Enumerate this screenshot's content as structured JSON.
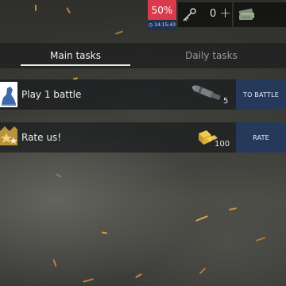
{
  "header": {
    "sale_percent": "50%",
    "sale_timer": "14:15:43",
    "keys_count": "0",
    "add_label": "+"
  },
  "tabs": [
    {
      "label": "Main tasks",
      "active": true
    },
    {
      "label": "Daily tasks",
      "active": false
    }
  ],
  "tasks": [
    {
      "title": "Play 1 battle",
      "reward_icon": "shell-icon",
      "reward_qty": "5",
      "action_label": "TO BATTLE"
    },
    {
      "title": "Rate us!",
      "reward_icon": "gold-bars-icon",
      "reward_qty": "100",
      "action_label": "RATE"
    }
  ],
  "colors": {
    "sale_red": "#d93a4c",
    "timer_navy": "#1f3050",
    "button_blue": "#253a5a"
  }
}
